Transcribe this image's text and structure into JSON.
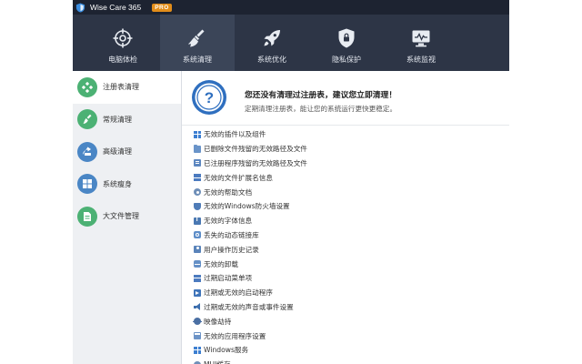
{
  "app": {
    "title": "Wise Care 365",
    "badge": "PRO",
    "logo_icon": "shield-logo-icon"
  },
  "nav": {
    "items": [
      {
        "label": "电脑体检",
        "icon": "crosshair-icon",
        "active": false
      },
      {
        "label": "系统清理",
        "icon": "broom-icon",
        "active": true
      },
      {
        "label": "系统优化",
        "icon": "rocket-icon",
        "active": false
      },
      {
        "label": "隐私保护",
        "icon": "lock-shield-icon",
        "active": false
      },
      {
        "label": "系统监视",
        "icon": "monitor-icon",
        "active": false
      }
    ]
  },
  "sidebar": {
    "items": [
      {
        "label": "注册表清理",
        "icon": "registry-icon",
        "color": "#4cb174",
        "active": true
      },
      {
        "label": "常规清理",
        "icon": "broom-icon",
        "color": "#4cb174",
        "active": false
      },
      {
        "label": "高级清理",
        "icon": "advanced-clean-icon",
        "color": "#4a86c5",
        "active": false
      },
      {
        "label": "系统瘦身",
        "icon": "windows-icon",
        "color": "#4a86c5",
        "active": false
      },
      {
        "label": "大文件管理",
        "icon": "file-manager-icon",
        "color": "#4cb174",
        "active": false
      }
    ]
  },
  "banner": {
    "icon": "question-icon",
    "title": "您还没有清理过注册表，建议您立即清理！",
    "subtitle": "定期清理注册表，能让您的系统运行更快更稳定。"
  },
  "checklist": {
    "items": [
      {
        "label": "无效的插件以及组件",
        "icon": "ic-win"
      },
      {
        "label": "已删除文件残留的无效路径及文件",
        "icon": "ic-folder"
      },
      {
        "label": "已注册程序残留的无效路径及文件",
        "icon": "ic-doc"
      },
      {
        "label": "无效的文件扩展名信息",
        "icon": "ic-list"
      },
      {
        "label": "无效的帮助文档",
        "icon": "ic-gear"
      },
      {
        "label": "无效的Windows防火墙设置",
        "icon": "ic-shield"
      },
      {
        "label": "无效的字体信息",
        "icon": "ic-font"
      },
      {
        "label": "丢失的动态链接库",
        "icon": "ic-link"
      },
      {
        "label": "用户操作历史记录",
        "icon": "ic-user"
      },
      {
        "label": "无效的卸载",
        "icon": "ic-pkg"
      },
      {
        "label": "过期启动菜单项",
        "icon": "ic-list"
      },
      {
        "label": "过期或无效的启动程序",
        "icon": "ic-startup"
      },
      {
        "label": "过期或无效的声音或事件设置",
        "icon": "ic-sound"
      },
      {
        "label": "映像劫持",
        "icon": "ic-bug"
      },
      {
        "label": "无效的应用程序设置",
        "icon": "ic-app"
      },
      {
        "label": "Windows服务",
        "icon": "ic-win"
      },
      {
        "label": "MUI缓存",
        "icon": "ic-circle"
      }
    ]
  }
}
